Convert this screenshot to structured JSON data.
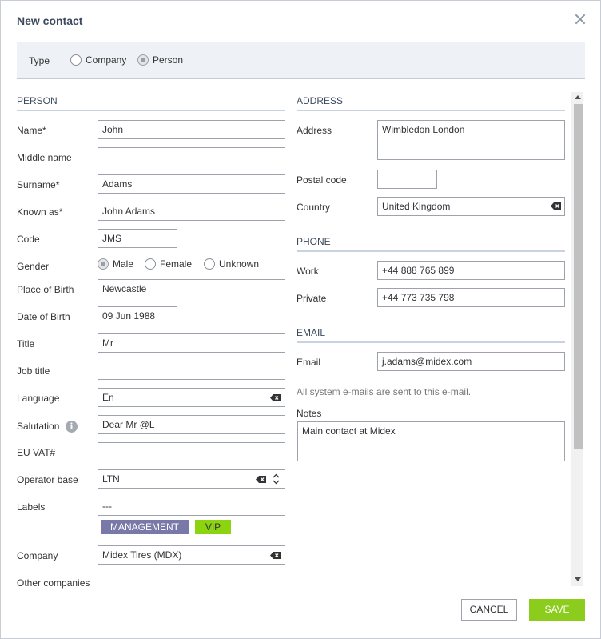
{
  "dialog": {
    "title": "New contact",
    "close_icon": "close-icon"
  },
  "type": {
    "label": "Type",
    "options": [
      {
        "label": "Company",
        "checked": false
      },
      {
        "label": "Person",
        "checked": true
      }
    ]
  },
  "person": {
    "heading": "PERSON",
    "name": {
      "label": "Name*",
      "value": "John"
    },
    "middle_name": {
      "label": "Middle name",
      "value": ""
    },
    "surname": {
      "label": "Surname*",
      "value": "Adams"
    },
    "known_as": {
      "label": "Known as*",
      "value": "John Adams"
    },
    "code": {
      "label": "Code",
      "value": "JMS"
    },
    "gender": {
      "label": "Gender",
      "options": [
        {
          "label": "Male",
          "checked": true
        },
        {
          "label": "Female",
          "checked": false
        },
        {
          "label": "Unknown",
          "checked": false
        }
      ]
    },
    "place_of_birth": {
      "label": "Place of Birth",
      "value": "Newcastle"
    },
    "date_of_birth": {
      "label": "Date of Birth",
      "value": "09 Jun 1988"
    },
    "title": {
      "label": "Title",
      "value": "Mr"
    },
    "job_title": {
      "label": "Job title",
      "value": ""
    },
    "language": {
      "label": "Language",
      "value": "En"
    },
    "salutation": {
      "label": "Salutation",
      "value": "Dear Mr @L",
      "info_icon": "info-icon"
    },
    "eu_vat": {
      "label": "EU VAT#",
      "value": ""
    },
    "operator_base": {
      "label": "Operator base",
      "value": "LTN"
    },
    "labels": {
      "label": "Labels",
      "value": "---",
      "tags": [
        {
          "label": "MANAGEMENT",
          "color": "#7979a9"
        },
        {
          "label": "VIP",
          "color": "#8cd40f"
        }
      ]
    },
    "company": {
      "label": "Company",
      "value": "Midex Tires (MDX)"
    },
    "other_companies": {
      "label": "Other companies",
      "value": ""
    }
  },
  "address": {
    "heading": "ADDRESS",
    "address": {
      "label": "Address",
      "value": "Wimbledon London"
    },
    "postal_code": {
      "label": "Postal code",
      "value": ""
    },
    "country": {
      "label": "Country",
      "value": "United Kingdom"
    }
  },
  "phone": {
    "heading": "PHONE",
    "work": {
      "label": "Work",
      "value": "+44 888 765 899"
    },
    "private": {
      "label": "Private",
      "value": "+44 773 735 798"
    }
  },
  "email": {
    "heading": "EMAIL",
    "email": {
      "label": "Email",
      "value": "j.adams@midex.com"
    },
    "hint": "All system e-mails are sent to this e-mail."
  },
  "notes": {
    "label": "Notes",
    "value": "Main contact at Midex"
  },
  "footer": {
    "cancel": "CANCEL",
    "save": "SAVE"
  },
  "colors": {
    "accent_green": "#8ccc1c",
    "heading": "#3c4a5c",
    "section_line": "#c9d3e0"
  }
}
